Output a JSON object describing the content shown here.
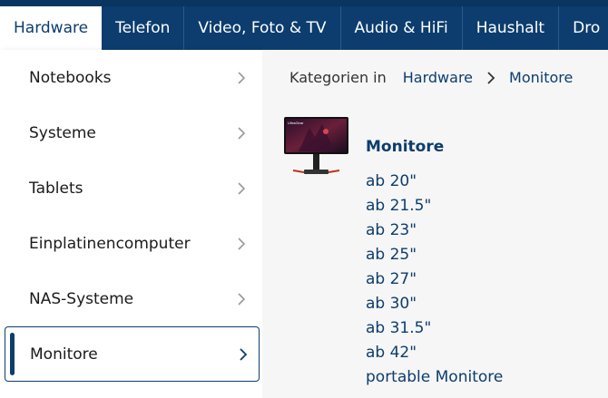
{
  "topnav": {
    "items": [
      "Hardware",
      "Telefon",
      "Video, Foto & TV",
      "Audio & HiFi",
      "Haushalt",
      "Dro"
    ]
  },
  "sidebar": {
    "items": [
      "Notebooks",
      "Systeme",
      "Tablets",
      "Einplatinencomputer",
      "NAS-Systeme",
      "Monitore"
    ],
    "active_index": 5
  },
  "breadcrumb": {
    "prefix": "Kategorien in",
    "links": [
      "Hardware",
      "Monitore"
    ]
  },
  "category": {
    "title": "Monitore",
    "thumbnail_brand": "UltraGear",
    "links": [
      "ab 20\"",
      "ab 21.5\"",
      "ab 23\"",
      "ab 25\"",
      "ab 27\"",
      "ab 30\"",
      "ab 31.5\"",
      "ab 42\"",
      "portable Monitore"
    ]
  },
  "colors": {
    "nav_bg": "#0c3d6e",
    "link": "#0c3d6e",
    "content_bg": "#f6f6f6"
  },
  "icons": {
    "sidebar_chevron": "chevron-right-icon",
    "breadcrumb_separator": "chevron-right-icon"
  }
}
